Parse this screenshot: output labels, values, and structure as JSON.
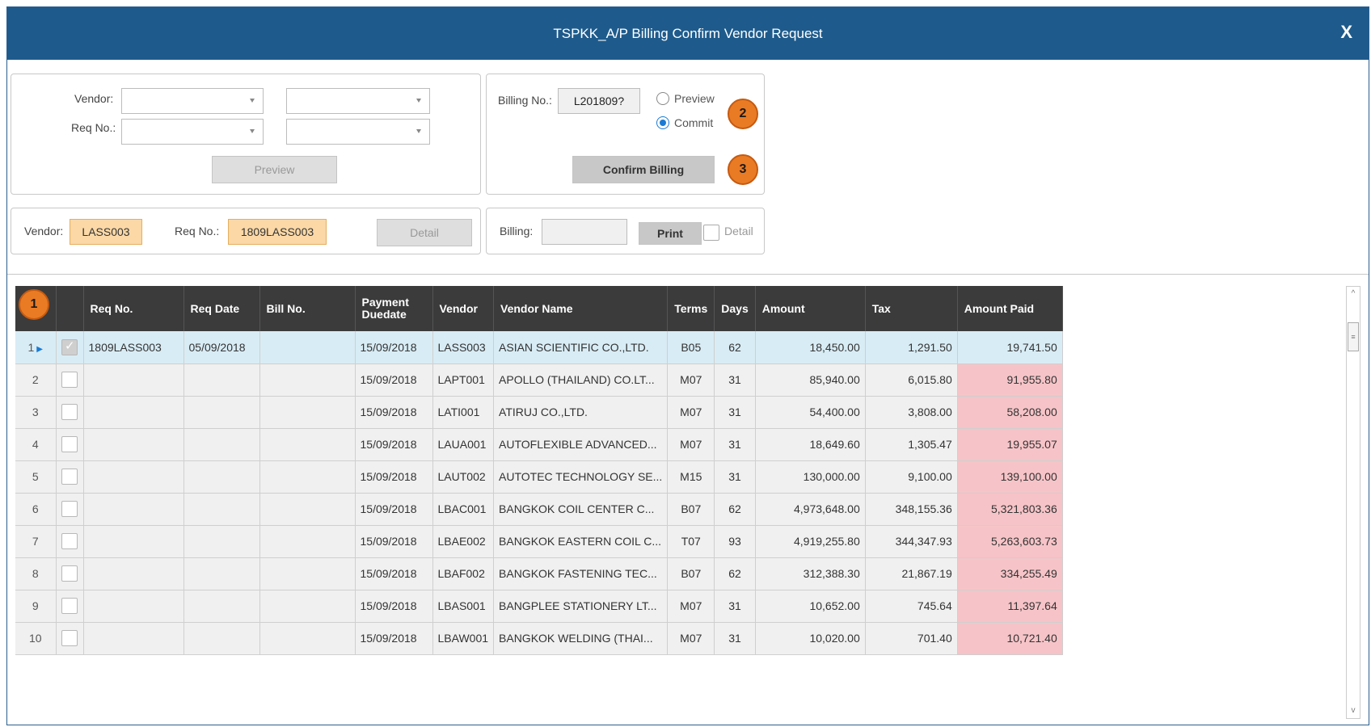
{
  "window": {
    "title": "TSPKK_A/P Billing Confirm Vendor Request",
    "close_glyph": "X"
  },
  "search": {
    "vendor_label": "Vendor:",
    "reqno_label": "Req No.:",
    "preview_button": "Preview"
  },
  "billing_action": {
    "billing_no_label": "Billing No.:",
    "billing_no_value": "L201809?",
    "radio_preview": "Preview",
    "radio_commit": "Commit",
    "selected_mode": "Commit",
    "confirm_button": "Confirm Billing",
    "step2": "2",
    "step3": "3"
  },
  "selection": {
    "vendor_label": "Vendor:",
    "vendor_value": "LASS003",
    "reqno_label": "Req No.:",
    "reqno_value": "1809LASS003",
    "detail_button": "Detail"
  },
  "print_panel": {
    "billing_label": "Billing:",
    "billing_value": "",
    "print_button": "Print",
    "detail_checkbox_label": "Detail"
  },
  "grid": {
    "step1": "1",
    "columns": [
      "Req No.",
      "Req Date",
      "Bill No.",
      "Payment Duedate",
      "Vendor",
      "Vendor Name",
      "Terms",
      "Days",
      "Amount",
      "Tax",
      "Amount Paid"
    ],
    "rows": [
      {
        "n": "1",
        "checked": true,
        "req_no": "1809LASS003",
        "req_date": "05/09/2018",
        "bill_no": "",
        "due": "15/09/2018",
        "vendor": "LASS003",
        "name": "ASIAN SCIENTIFIC CO.,LTD.",
        "terms": "B05",
        "days": "62",
        "amount": "18,450.00",
        "tax": "1,291.50",
        "paid": "19,741.50"
      },
      {
        "n": "2",
        "checked": false,
        "req_no": "",
        "req_date": "",
        "bill_no": "",
        "due": "15/09/2018",
        "vendor": "LAPT001",
        "name": "APOLLO (THAILAND) CO.LT...",
        "terms": "M07",
        "days": "31",
        "amount": "85,940.00",
        "tax": "6,015.80",
        "paid": "91,955.80"
      },
      {
        "n": "3",
        "checked": false,
        "req_no": "",
        "req_date": "",
        "bill_no": "",
        "due": "15/09/2018",
        "vendor": "LATI001",
        "name": "ATIRUJ CO.,LTD.",
        "terms": "M07",
        "days": "31",
        "amount": "54,400.00",
        "tax": "3,808.00",
        "paid": "58,208.00"
      },
      {
        "n": "4",
        "checked": false,
        "req_no": "",
        "req_date": "",
        "bill_no": "",
        "due": "15/09/2018",
        "vendor": "LAUA001",
        "name": "AUTOFLEXIBLE ADVANCED...",
        "terms": "M07",
        "days": "31",
        "amount": "18,649.60",
        "tax": "1,305.47",
        "paid": "19,955.07"
      },
      {
        "n": "5",
        "checked": false,
        "req_no": "",
        "req_date": "",
        "bill_no": "",
        "due": "15/09/2018",
        "vendor": "LAUT002",
        "name": "AUTOTEC TECHNOLOGY SE...",
        "terms": "M15",
        "days": "31",
        "amount": "130,000.00",
        "tax": "9,100.00",
        "paid": "139,100.00"
      },
      {
        "n": "6",
        "checked": false,
        "req_no": "",
        "req_date": "",
        "bill_no": "",
        "due": "15/09/2018",
        "vendor": "LBAC001",
        "name": "BANGKOK COIL CENTER C...",
        "terms": "B07",
        "days": "62",
        "amount": "4,973,648.00",
        "tax": "348,155.36",
        "paid": "5,321,803.36"
      },
      {
        "n": "7",
        "checked": false,
        "req_no": "",
        "req_date": "",
        "bill_no": "",
        "due": "15/09/2018",
        "vendor": "LBAE002",
        "name": "BANGKOK EASTERN COIL C...",
        "terms": "T07",
        "days": "93",
        "amount": "4,919,255.80",
        "tax": "344,347.93",
        "paid": "5,263,603.73"
      },
      {
        "n": "8",
        "checked": false,
        "req_no": "",
        "req_date": "",
        "bill_no": "",
        "due": "15/09/2018",
        "vendor": "LBAF002",
        "name": "BANGKOK FASTENING TEC...",
        "terms": "B07",
        "days": "62",
        "amount": "312,388.30",
        "tax": "21,867.19",
        "paid": "334,255.49"
      },
      {
        "n": "9",
        "checked": false,
        "req_no": "",
        "req_date": "",
        "bill_no": "",
        "due": "15/09/2018",
        "vendor": "LBAS001",
        "name": "BANGPLEE STATIONERY LT...",
        "terms": "M07",
        "days": "31",
        "amount": "10,652.00",
        "tax": "745.64",
        "paid": "11,397.64"
      },
      {
        "n": "10",
        "checked": false,
        "req_no": "",
        "req_date": "",
        "bill_no": "",
        "due": "15/09/2018",
        "vendor": "LBAW001",
        "name": "BANGKOK WELDING (THAI...",
        "terms": "M07",
        "days": "31",
        "amount": "10,020.00",
        "tax": "701.40",
        "paid": "10,721.40"
      }
    ]
  },
  "colors": {
    "titlebar": "#1e5b8c",
    "badge": "#e97b24",
    "field_highlight": "#fbd8a6",
    "paid_highlight": "#f6c4c8",
    "selected_row": "#d8ecf5",
    "radio_accent": "#1a7bd4"
  }
}
